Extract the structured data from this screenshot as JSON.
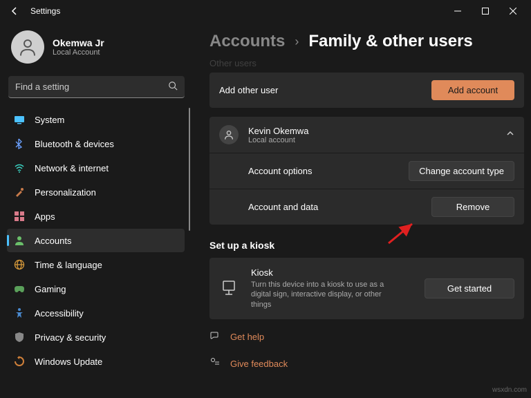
{
  "titlebar": {
    "title": "Settings"
  },
  "profile": {
    "name": "Okemwa Jr",
    "sub": "Local Account"
  },
  "search": {
    "placeholder": "Find a setting"
  },
  "nav": [
    {
      "label": "System",
      "icon": "system",
      "color": "#4cc2ff"
    },
    {
      "label": "Bluetooth & devices",
      "icon": "bluetooth",
      "color": "#6aa0ff"
    },
    {
      "label": "Network & internet",
      "icon": "wifi",
      "color": "#3ad0c0"
    },
    {
      "label": "Personalization",
      "icon": "brush",
      "color": "#c77a4a"
    },
    {
      "label": "Apps",
      "icon": "apps",
      "color": "#d87a8a"
    },
    {
      "label": "Accounts",
      "icon": "person",
      "color": "#6abf6a"
    },
    {
      "label": "Time & language",
      "icon": "globe",
      "color": "#d89a3a"
    },
    {
      "label": "Gaming",
      "icon": "game",
      "color": "#5aa05a"
    },
    {
      "label": "Accessibility",
      "icon": "access",
      "color": "#4a8ad0"
    },
    {
      "label": "Privacy & security",
      "icon": "shield",
      "color": "#888"
    },
    {
      "label": "Windows Update",
      "icon": "update",
      "color": "#d0803a"
    }
  ],
  "breadcrumb": {
    "root": "Accounts",
    "page": "Family & other users"
  },
  "other_users": {
    "heading_cut": "Other users",
    "add_label": "Add other user",
    "add_btn": "Add account",
    "user": {
      "name": "Kevin Okemwa",
      "sub": "Local account"
    },
    "opt_label": "Account options",
    "opt_btn": "Change account type",
    "data_label": "Account and data",
    "data_btn": "Remove"
  },
  "kiosk": {
    "heading": "Set up a kiosk",
    "title": "Kiosk",
    "desc": "Turn this device into a kiosk to use as a digital sign, interactive display, or other things",
    "btn": "Get started"
  },
  "links": {
    "help": "Get help",
    "feedback": "Give feedback"
  },
  "watermark": "wsxdn.com"
}
